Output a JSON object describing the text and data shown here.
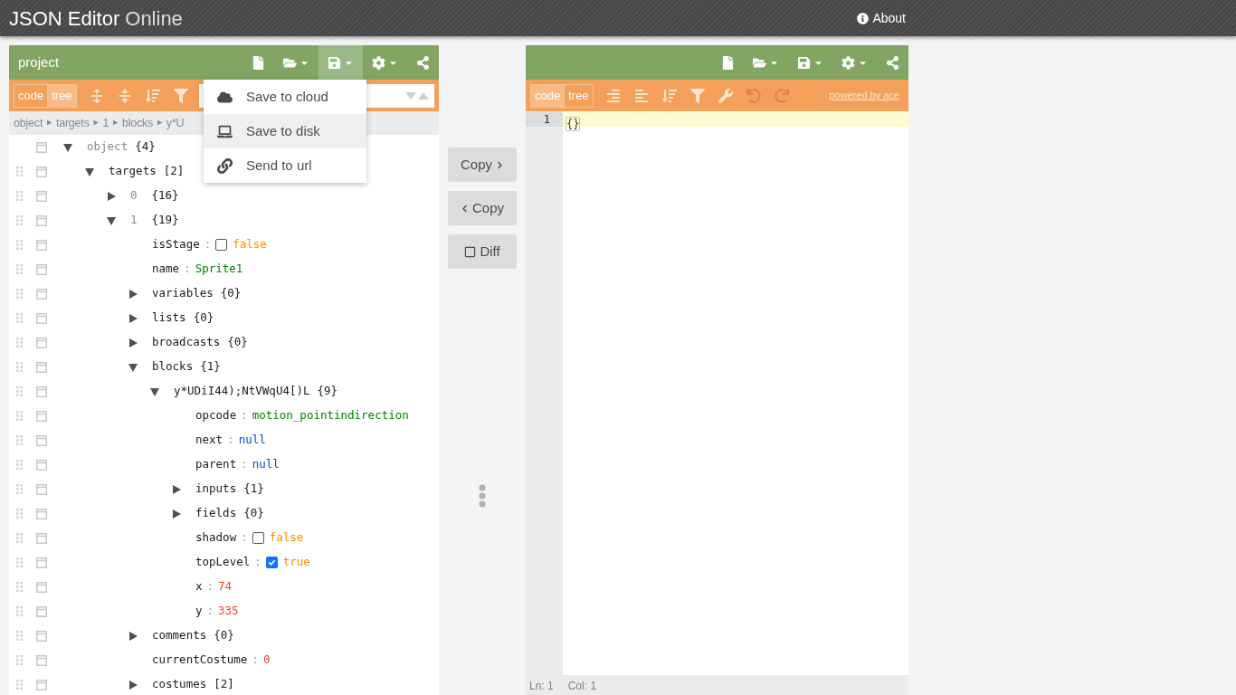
{
  "app": {
    "title": "JSON Editor",
    "subtitle": "Online",
    "about": "About"
  },
  "left": {
    "title": "project",
    "header_tools": [
      {
        "kind": "new",
        "active": false
      },
      {
        "kind": "open",
        "active": false
      },
      {
        "kind": "save",
        "active": true
      },
      {
        "kind": "settings",
        "active": false
      },
      {
        "kind": "share",
        "active": false
      }
    ],
    "modes": [
      {
        "label": "code",
        "selected": false
      },
      {
        "label": "tree",
        "selected": true
      }
    ],
    "tools": [
      {
        "kind": "expand",
        "disabled": false
      },
      {
        "kind": "collapse",
        "disabled": false
      },
      {
        "kind": "sort",
        "disabled": false
      },
      {
        "kind": "filter",
        "disabled": false
      }
    ],
    "save_menu": [
      {
        "kind": "cloud",
        "label": "Save to cloud",
        "selected": false
      },
      {
        "kind": "disk",
        "label": "Save to disk",
        "selected": true
      },
      {
        "kind": "url",
        "label": "Send to url",
        "selected": false
      }
    ],
    "breadcrumb": {
      "separator": "►",
      "items": [
        "object",
        "targets",
        "1",
        "blocks",
        "y*U"
      ]
    },
    "tree": {
      "key": "object",
      "muted": true,
      "count": "{4}",
      "expanded": true,
      "children": [
        {
          "key": "targets",
          "muted": false,
          "count": "[2]",
          "expanded": true,
          "children": [
            {
              "key": "0",
              "muted": true,
              "count": "{16}",
              "expanded": false
            },
            {
              "key": "1",
              "muted": true,
              "count": "{19}",
              "expanded": true,
              "children": [
                {
                  "key": "isStage",
                  "muted": false,
                  "kind": "boolean",
                  "separator": ":",
                  "value": "false",
                  "checked": false
                },
                {
                  "key": "name",
                  "muted": false,
                  "kind": "string",
                  "separator": ":",
                  "value": "Sprite1"
                },
                {
                  "key": "variables",
                  "muted": false,
                  "count": "{0}",
                  "expanded": false
                },
                {
                  "key": "lists",
                  "muted": false,
                  "count": "{0}",
                  "expanded": false
                },
                {
                  "key": "broadcasts",
                  "muted": false,
                  "count": "{0}",
                  "expanded": false
                },
                {
                  "key": "blocks",
                  "muted": false,
                  "count": "{1}",
                  "expanded": true,
                  "children": [
                    {
                      "key": "y*UDiI44);NtVWqU4[)L",
                      "muted": false,
                      "count": "{9}",
                      "expanded": true,
                      "children": [
                        {
                          "key": "opcode",
                          "muted": false,
                          "kind": "string",
                          "separator": ":",
                          "value": "motion_pointindirection"
                        },
                        {
                          "key": "next",
                          "muted": false,
                          "kind": "null",
                          "separator": ":",
                          "value": "null"
                        },
                        {
                          "key": "parent",
                          "muted": false,
                          "kind": "null",
                          "separator": ":",
                          "value": "null"
                        },
                        {
                          "key": "inputs",
                          "muted": false,
                          "count": "{1}",
                          "expanded": false
                        },
                        {
                          "key": "fields",
                          "muted": false,
                          "count": "{0}",
                          "expanded": false
                        },
                        {
                          "key": "shadow",
                          "muted": false,
                          "kind": "boolean",
                          "separator": ":",
                          "value": "false",
                          "checked": false
                        },
                        {
                          "key": "topLevel",
                          "muted": false,
                          "kind": "boolean",
                          "separator": ":",
                          "value": "true",
                          "checked": true
                        },
                        {
                          "key": "x",
                          "muted": false,
                          "kind": "number",
                          "separator": ":",
                          "value": "74"
                        },
                        {
                          "key": "y",
                          "muted": false,
                          "kind": "number",
                          "separator": ":",
                          "value": "335"
                        }
                      ]
                    }
                  ]
                },
                {
                  "key": "comments",
                  "muted": false,
                  "count": "{0}",
                  "expanded": false
                },
                {
                  "key": "currentCostume",
                  "muted": false,
                  "kind": "number",
                  "separator": ":",
                  "value": "0"
                },
                {
                  "key": "costumes",
                  "muted": false,
                  "count": "[2]",
                  "expanded": false
                }
              ]
            }
          ]
        }
      ]
    }
  },
  "middle": {
    "buttons": [
      {
        "kind": "copy_right",
        "label": "Copy"
      },
      {
        "kind": "copy_left",
        "label": "Copy"
      },
      {
        "kind": "diff",
        "label": "Diff"
      }
    ]
  },
  "right": {
    "header_tools": [
      {
        "kind": "new",
        "active": false
      },
      {
        "kind": "open",
        "active": false
      },
      {
        "kind": "save",
        "active": false
      },
      {
        "kind": "settings",
        "active": false
      },
      {
        "kind": "share",
        "active": false
      }
    ],
    "modes": [
      {
        "label": "code",
        "selected": true
      },
      {
        "label": "tree",
        "selected": false
      }
    ],
    "tools": [
      {
        "kind": "format",
        "disabled": false
      },
      {
        "kind": "compact",
        "disabled": false
      },
      {
        "kind": "sort",
        "disabled": false
      },
      {
        "kind": "filter",
        "disabled": false
      },
      {
        "kind": "repair",
        "disabled": false
      },
      {
        "kind": "undo",
        "disabled": true
      },
      {
        "kind": "redo",
        "disabled": true
      }
    ],
    "powered_by": "powered by ace",
    "lines": [
      {
        "number": "1",
        "text": "{}",
        "active": true
      }
    ],
    "status": {
      "line": "Ln: 1",
      "column": "Col: 1"
    }
  }
}
